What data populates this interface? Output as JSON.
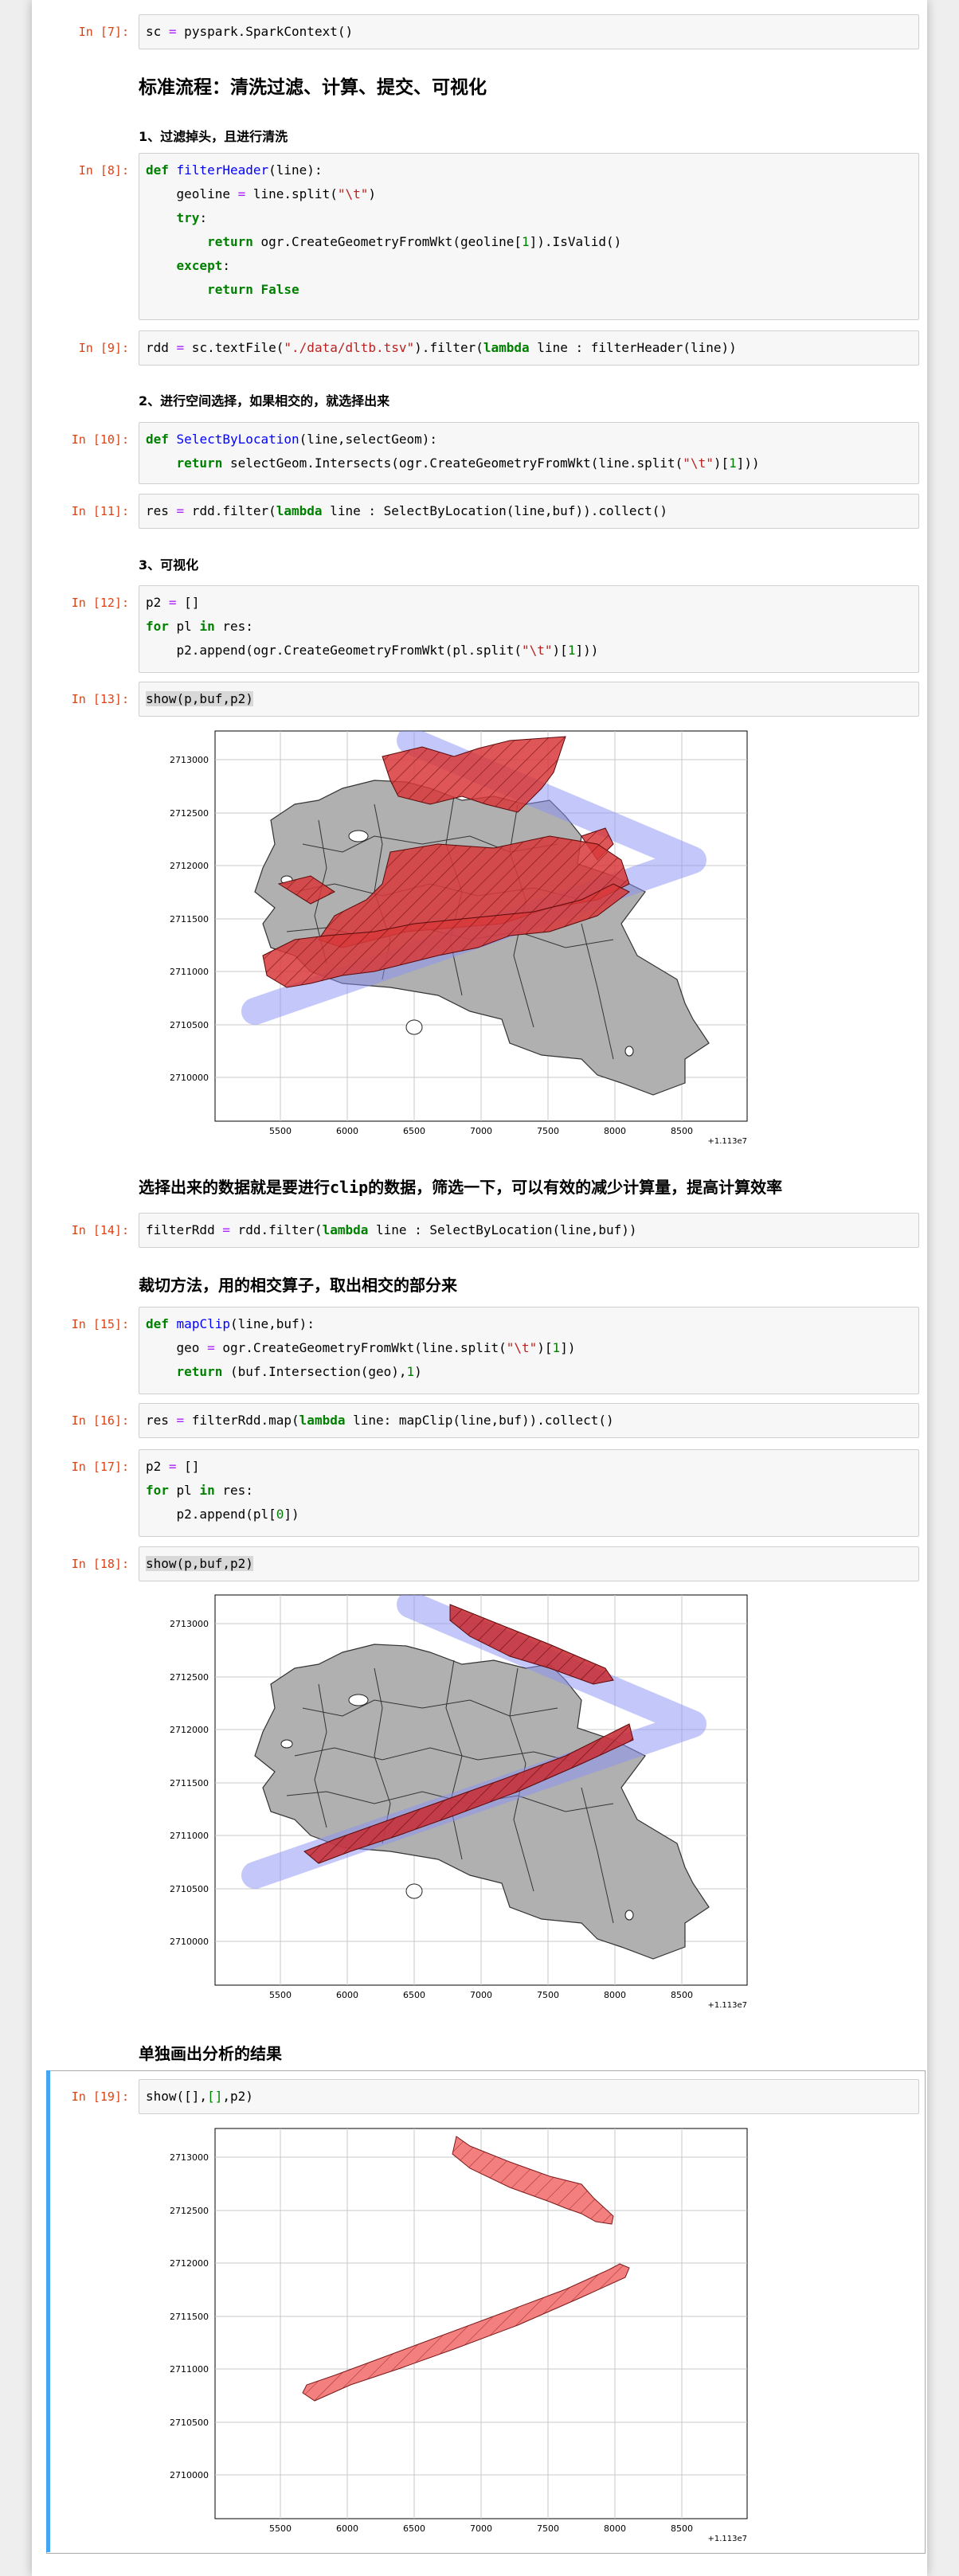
{
  "cells": [
    {
      "prompt": "In [7]:",
      "code": [
        [
          "sc = pyspark.SparkContext()"
        ]
      ]
    },
    {
      "prompt": "In [8]:"
    },
    {
      "prompt": "In [9]:"
    },
    {
      "prompt": "In [10]:"
    },
    {
      "prompt": "In [11]:"
    },
    {
      "prompt": "In [12]:"
    },
    {
      "prompt": "In [13]:",
      "code_text": "show(p,buf,p2)"
    },
    {
      "prompt": "In [14]:"
    },
    {
      "prompt": "In [15]:"
    },
    {
      "prompt": "In [16]:"
    },
    {
      "prompt": "In [17]:"
    },
    {
      "prompt": "In [18]:",
      "code_text": "show(p,buf,p2)"
    },
    {
      "prompt": "In [19]:"
    }
  ],
  "markdown": {
    "title": "标准流程：清洗过滤、计算、提交、可视化",
    "step1": "1、过滤掉头，且进行清洗",
    "step2": "2、进行空间选择，如果相交的，就选择出来",
    "step3": "3、可视化",
    "note_pre": "选择出来的数据就是要进行",
    "note_code": "clip",
    "note_post": "的数据，筛选一下，可以有效的减少计算量，提高计算效率",
    "clip_title": "裁切方法，用的相交算子，取出相交的部分来",
    "result_title": "单独画出分析的结果"
  },
  "plots": {
    "y_ticks": [
      "2713000",
      "2712500",
      "2712000",
      "2711500",
      "2711000",
      "2710500",
      "2710000"
    ],
    "x_ticks": [
      "5500",
      "6000",
      "6500",
      "7000",
      "7500",
      "8000",
      "8500"
    ],
    "offset": "+1.113e7",
    "colors": {
      "land": "#b0b0b0",
      "buffer": "#b3b6f7",
      "selected": "#d9383a",
      "result": "#f47f7f"
    }
  },
  "chart_data": [
    {
      "type": "map-plot",
      "ylim": [
        2709800,
        2713200
      ],
      "xlim": [
        5000,
        9000
      ],
      "x_offset": "+1.113e7",
      "layers": [
        "land parcels (grey)",
        "buffer (blue)",
        "selected parcels (red, hatched)"
      ]
    },
    {
      "type": "map-plot",
      "ylim": [
        2709800,
        2713200
      ],
      "xlim": [
        5000,
        9000
      ],
      "x_offset": "+1.113e7",
      "layers": [
        "land parcels (grey)",
        "buffer (blue)",
        "clipped parcels (red, hatched)"
      ]
    },
    {
      "type": "map-plot",
      "ylim": [
        2709800,
        2713200
      ],
      "xlim": [
        5000,
        9000
      ],
      "x_offset": "+1.113e7",
      "layers": [
        "clipped result (light red, hatched)"
      ]
    }
  ]
}
